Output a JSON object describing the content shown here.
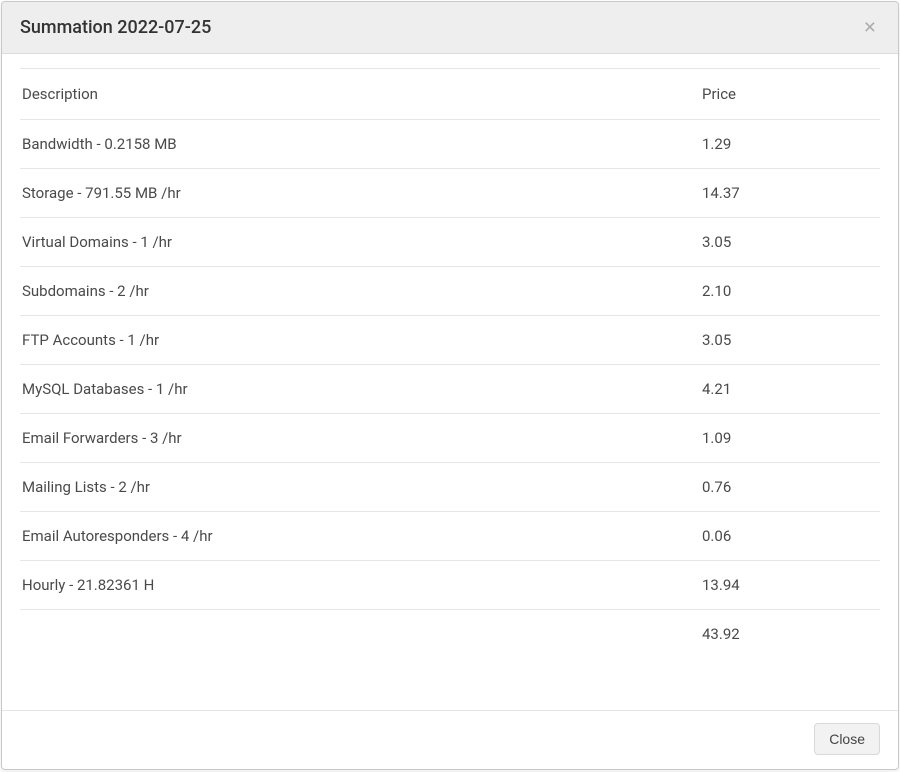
{
  "modal": {
    "title": "Summation 2022-07-25",
    "close_glyph": "×",
    "close_button_label": "Close"
  },
  "table": {
    "headers": {
      "description": "Description",
      "price": "Price"
    },
    "rows": [
      {
        "description": "Bandwidth - 0.2158 MB",
        "price": "1.29"
      },
      {
        "description": "Storage - 791.55 MB /hr",
        "price": "14.37"
      },
      {
        "description": "Virtual Domains - 1 /hr",
        "price": "3.05"
      },
      {
        "description": "Subdomains - 2 /hr",
        "price": "2.10"
      },
      {
        "description": "FTP Accounts - 1 /hr",
        "price": "3.05"
      },
      {
        "description": "MySQL Databases - 1  /hr",
        "price": "4.21"
      },
      {
        "description": "Email Forwarders - 3 /hr",
        "price": "1.09"
      },
      {
        "description": "Mailing Lists - 2  /hr",
        "price": "0.76"
      },
      {
        "description": "Email Autoresponders - 4 /hr",
        "price": "0.06"
      },
      {
        "description": "Hourly - 21.82361 H",
        "price": "13.94"
      }
    ],
    "total": {
      "description": "",
      "price": "43.92"
    }
  }
}
